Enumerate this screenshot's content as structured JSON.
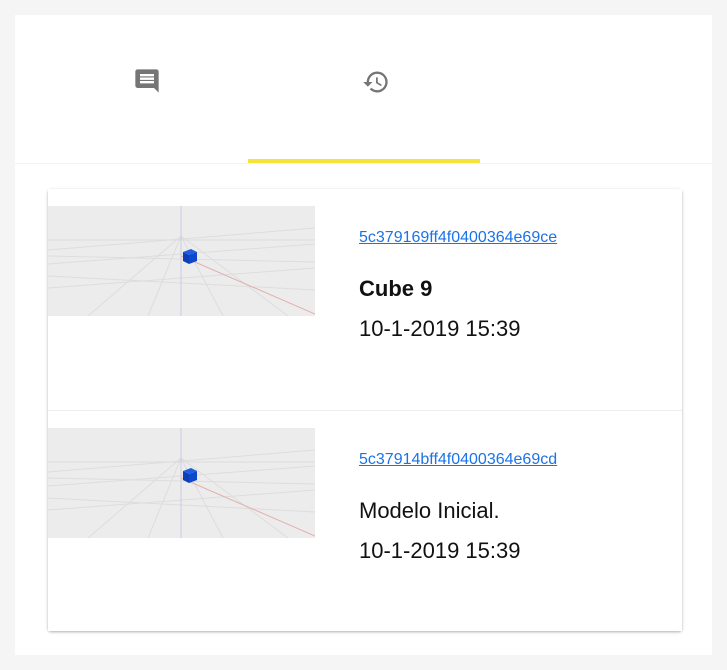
{
  "tabs": [
    {
      "id": "comments",
      "icon": "comment-icon",
      "active": false
    },
    {
      "id": "history",
      "icon": "history-icon",
      "active": true
    }
  ],
  "accent_color": "#f5e33a",
  "commits": [
    {
      "id": "5c379169ff4f0400364e69ce",
      "message": "Cube 9",
      "message_bold": true,
      "timestamp": "10-1-2019 15:39",
      "thumbnail": "blue-cube-preview"
    },
    {
      "id": "5c37914bff4f0400364e69cd",
      "message": "Modelo Inicial.",
      "message_bold": false,
      "timestamp": "10-1-2019 15:39",
      "thumbnail": "blue-cube-preview"
    }
  ]
}
